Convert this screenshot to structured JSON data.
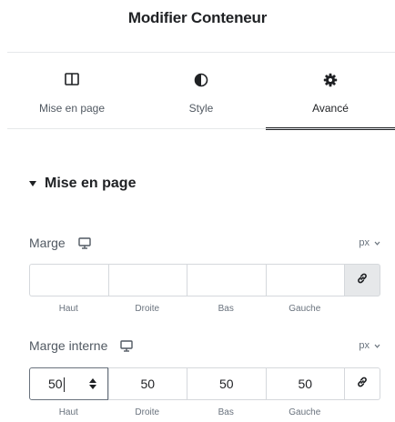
{
  "panel": {
    "title": "Modifier Conteneur"
  },
  "tabs": [
    {
      "label": "Mise en page",
      "icon": "columns-icon"
    },
    {
      "label": "Style",
      "icon": "contrast-icon"
    },
    {
      "label": "Avancé",
      "icon": "gear-icon",
      "active": true
    }
  ],
  "section": {
    "title": "Mise en page",
    "expanded": true
  },
  "margin": {
    "label": "Marge",
    "unit": "px",
    "values": [
      "",
      "",
      "",
      ""
    ],
    "linked": false
  },
  "padding": {
    "label": "Marge interne",
    "unit": "px",
    "values": [
      "50",
      "50",
      "50",
      "50"
    ],
    "linked": true
  },
  "sides": [
    "Haut",
    "Droite",
    "Bas",
    "Gauche"
  ],
  "colors": {
    "text": "#1f2124",
    "muted": "#69727d",
    "border": "#d5d8dc",
    "linked_bg": "#e6e8ea"
  }
}
